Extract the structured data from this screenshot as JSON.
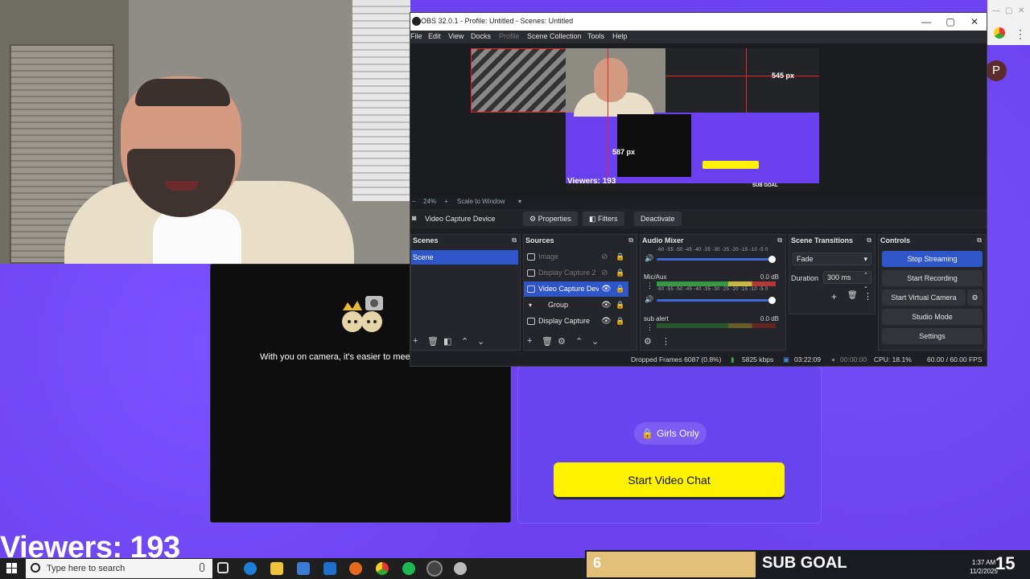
{
  "site": {
    "avatar_letter": "P",
    "stranger_caption": "With you on camera, it's easier to mee",
    "girls_only": "Girls Only",
    "start_video_chat": "Start Video Chat"
  },
  "overlay": {
    "viewers": "Viewers: 193",
    "sub_goal_count": "6",
    "sub_goal_label": "SUB GOAL",
    "sub_goal_target": "15"
  },
  "taskbar": {
    "search_placeholder": "Type here to search",
    "time": "1:37 AM",
    "date": "11/2/2025"
  },
  "obs": {
    "title": "OBS 32.0.1 - Profile: Untitled - Scenes: Untitled",
    "menu": [
      "File",
      "Edit",
      "View",
      "Docks",
      "Profile",
      "Scene Collection",
      "Tools",
      "Help"
    ],
    "preview": {
      "zoom": "24%",
      "scale_mode": "Scale to Window",
      "width_label": "545 px",
      "height_label": "587 px",
      "canvas_viewers": "Viewers: 193",
      "canvas_sub_goal": "SUB GOAL"
    },
    "source_bar": {
      "selected_source": "Video Capture Device",
      "properties": "Properties",
      "filters": "Filters",
      "deactivate": "Deactivate"
    },
    "scenes": {
      "title": "Scenes",
      "items": [
        "Scene"
      ]
    },
    "sources": {
      "title": "Sources",
      "items": [
        {
          "label": "Image",
          "visible": false
        },
        {
          "label": "Display Capture 2",
          "visible": false
        },
        {
          "label": "Video Capture Dev",
          "visible": true
        },
        {
          "label": "Group",
          "visible": true
        },
        {
          "label": "Display Capture",
          "visible": true
        }
      ]
    },
    "audio_mixer": {
      "title": "Audio Mixer",
      "scale": "-60 -55 -50 -45 -40 -35 -30 -25 -20 -15 -10 -5 0",
      "channels": [
        {
          "name": "Mic/Aux",
          "db": "0.0 dB"
        },
        {
          "name": "sub alert",
          "db": "0.0 dB"
        }
      ]
    },
    "transitions": {
      "title": "Scene Transitions",
      "type": "Fade",
      "duration_label": "Duration",
      "duration_value": "300 ms"
    },
    "controls": {
      "title": "Controls",
      "stop_streaming": "Stop Streaming",
      "start_recording": "Start Recording",
      "start_virtual_camera": "Start Virtual Camera",
      "studio_mode": "Studio Mode",
      "settings": "Settings"
    },
    "status": {
      "dropped_frames": "Dropped Frames 6087 (0.8%)",
      "bitrate": "5825 kbps",
      "stream_time": "03:22:09",
      "record_time": "00:00:00",
      "cpu": "CPU: 18.1%",
      "fps": "60.00 / 60.00 FPS"
    }
  },
  "colors": {
    "site_bg": "#6b42ee",
    "obs_bg": "#1e1f24",
    "obs_accent": "#2f56c9",
    "cta_yellow": "#fff200"
  }
}
